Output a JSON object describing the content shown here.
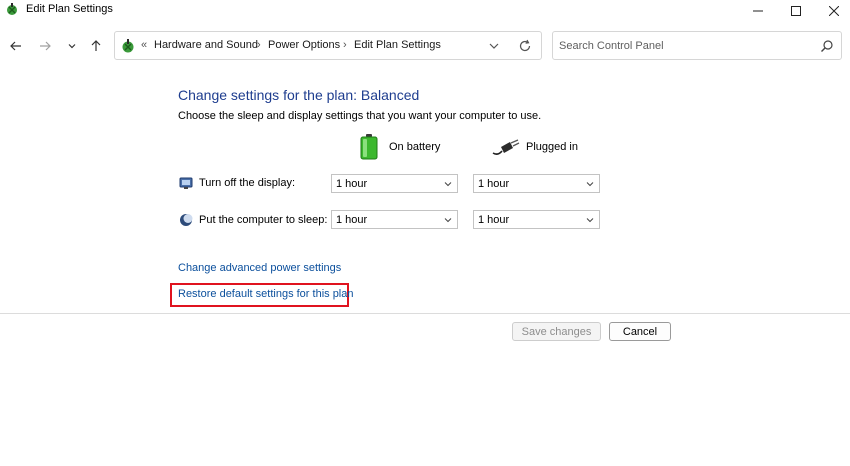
{
  "window": {
    "title": "Edit Plan Settings",
    "app_icon": "power-options-icon",
    "controls": {
      "minimize": "minimize-icon",
      "maximize": "maximize-icon",
      "close": "close-icon"
    }
  },
  "nav": {
    "back_icon": "arrow-left-icon",
    "forward_icon": "arrow-right-icon",
    "recent_icon": "chevron-down-icon",
    "up_icon": "arrow-up-icon",
    "address": {
      "overflow": "«",
      "crumbs": [
        "Hardware and Sound",
        "Power Options",
        "Edit Plan Settings"
      ],
      "separator": "›"
    },
    "refresh_icon": "refresh-icon",
    "search": {
      "placeholder": "Search Control Panel",
      "value": ""
    }
  },
  "main": {
    "heading": "Change settings for the plan: Balanced",
    "subtitle": "Choose the sleep and display settings that you want your computer to use.",
    "columns": [
      {
        "label": "On battery",
        "icon": "battery-icon",
        "color": "#3cb82e"
      },
      {
        "label": "Plugged in",
        "icon": "power-plug-icon"
      }
    ],
    "rows": [
      {
        "label": "Turn off the display:",
        "icon": "display-icon",
        "on_battery": "1 hour",
        "plugged_in": "1 hour"
      },
      {
        "label": "Put the computer to sleep:",
        "icon": "sleep-moon-icon",
        "on_battery": "1 hour",
        "plugged_in": "1 hour"
      }
    ],
    "links": {
      "advanced": "Change advanced power settings",
      "restore": "Restore default settings for this plan"
    }
  },
  "footer": {
    "save_label": "Save changes",
    "save_enabled": false,
    "cancel_label": "Cancel"
  },
  "colors": {
    "heading": "#1e3d8f",
    "link": "#0b4f9c",
    "highlight": "#e0131f"
  }
}
